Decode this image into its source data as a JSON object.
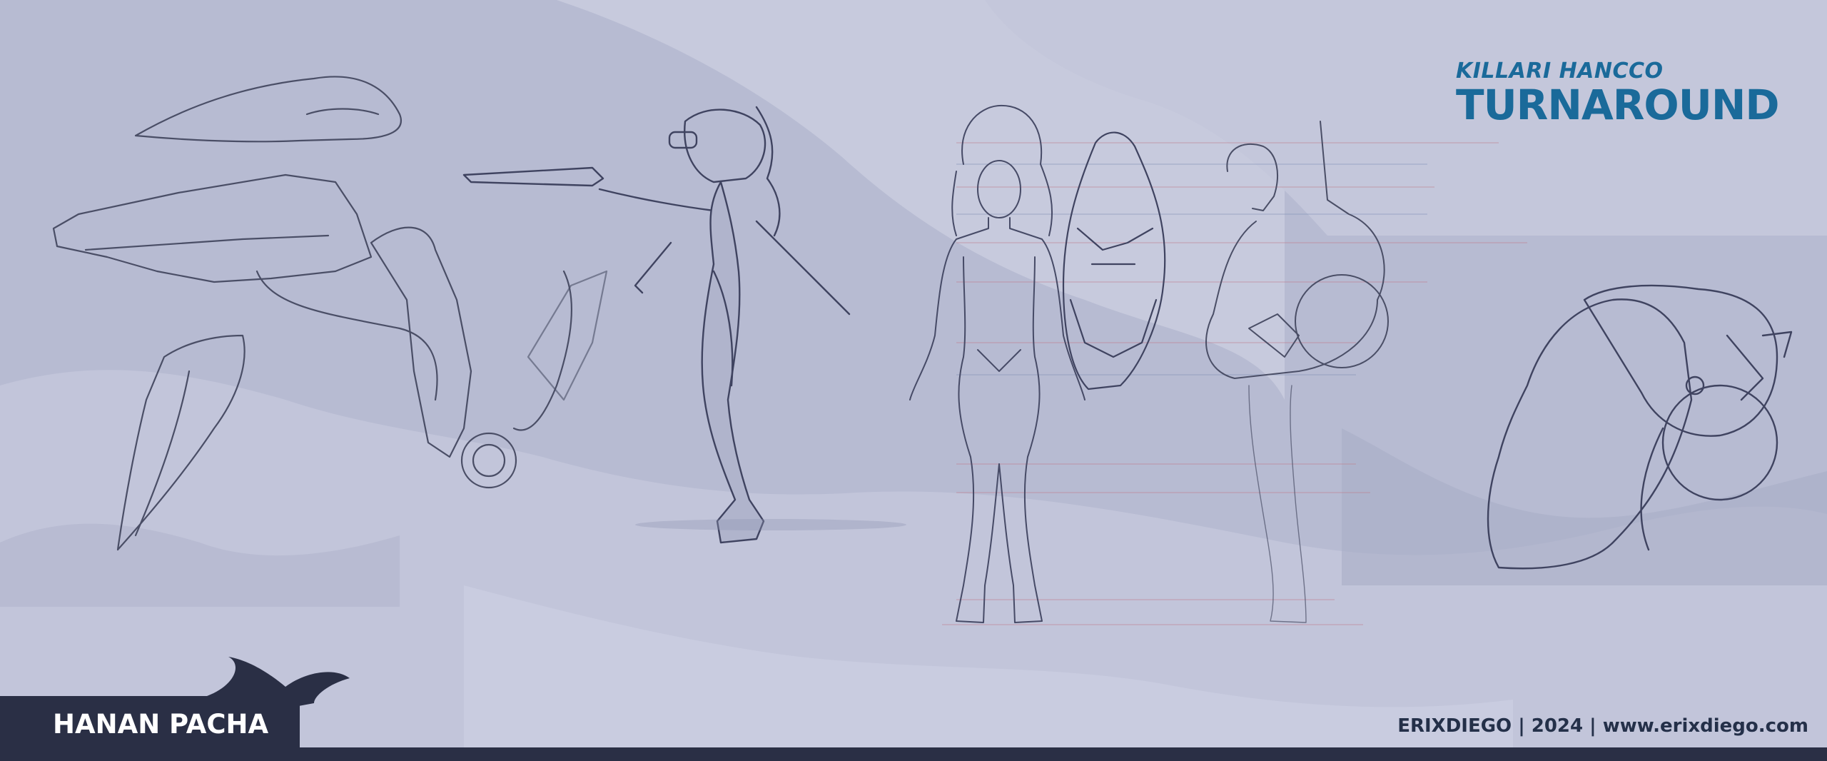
{
  "header": {
    "subtitle": "KILLARI HANCCO",
    "title": "TURNAROUND"
  },
  "footer": {
    "project": "HANAN PACHA",
    "credits": "ERIXDIEGO | 2024 | www.erixdiego.com"
  },
  "colors": {
    "background": "#b7bbd2",
    "cloud_light": "#c7cadd",
    "cloud_dark": "#a7acc5",
    "title_blue": "#1a6a9a",
    "footer_bar": "#2a2f45",
    "credits_text": "#243049",
    "sketch_line": "#4a4e66"
  }
}
